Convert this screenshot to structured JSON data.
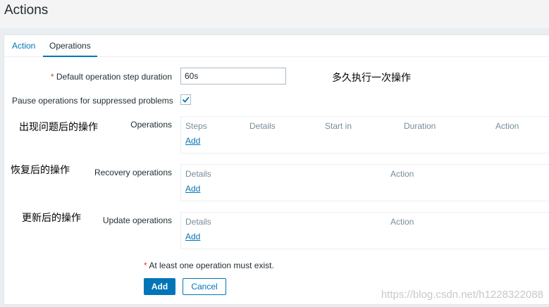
{
  "header": {
    "title": "Actions"
  },
  "tabs": [
    {
      "label": "Action"
    },
    {
      "label": "Operations"
    }
  ],
  "form": {
    "step_duration": {
      "required_mark": "*",
      "label": "Default operation step duration",
      "value": "60s"
    },
    "pause_suppressed": {
      "label": "Pause operations for suppressed problems",
      "checked": true
    },
    "operations": {
      "label": "Operations",
      "columns": [
        "Steps",
        "Details",
        "Start in",
        "Duration",
        "Action"
      ],
      "add_label": "Add"
    },
    "recovery_operations": {
      "label": "Recovery operations",
      "columns": [
        "Details",
        "Action"
      ],
      "add_label": "Add"
    },
    "update_operations": {
      "label": "Update operations",
      "columns": [
        "Details",
        "Action"
      ],
      "add_label": "Add"
    },
    "hint": {
      "required_mark": "*",
      "text": "At least one operation must exist."
    },
    "buttons": {
      "add": "Add",
      "cancel": "Cancel"
    }
  },
  "annotations": {
    "step_duration": "多久执行一次操作",
    "operations": "出现问题后的操作",
    "recovery": "恢复后的操作",
    "update": "更新后的操作"
  },
  "watermark": "https://blog.csdn.net/h1228322088",
  "colors": {
    "accent": "#0275b8",
    "required": "#e33734",
    "muted": "#768d99"
  }
}
